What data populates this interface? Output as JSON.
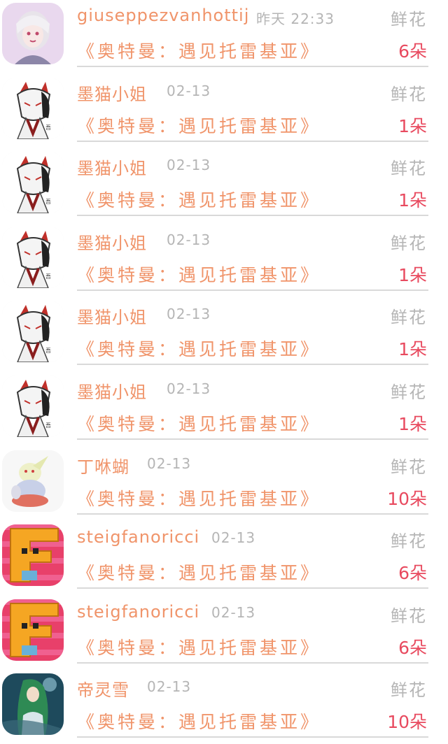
{
  "gift_list": {
    "items": [
      {
        "user": "giuseppezvanhottij",
        "time": "昨天 22:33",
        "gift_type": "鲜花",
        "book": "《奥特曼：遇见托雷基亚》",
        "amount": "6朵",
        "avatar": "girl-avatar"
      },
      {
        "user": "墨猫小姐",
        "time": "02-13",
        "gift_type": "鲜花",
        "book": "《奥特曼：遇见托雷基亚》",
        "amount": "1朵",
        "avatar": "fox-mask-avatar"
      },
      {
        "user": "墨猫小姐",
        "time": "02-13",
        "gift_type": "鲜花",
        "book": "《奥特曼：遇见托雷基亚》",
        "amount": "1朵",
        "avatar": "fox-mask-avatar"
      },
      {
        "user": "墨猫小姐",
        "time": "02-13",
        "gift_type": "鲜花",
        "book": "《奥特曼：遇见托雷基亚》",
        "amount": "1朵",
        "avatar": "fox-mask-avatar"
      },
      {
        "user": "墨猫小姐",
        "time": "02-13",
        "gift_type": "鲜花",
        "book": "《奥特曼：遇见托雷基亚》",
        "amount": "1朵",
        "avatar": "fox-mask-avatar"
      },
      {
        "user": "墨猫小姐",
        "time": "02-13",
        "gift_type": "鲜花",
        "book": "《奥特曼：遇见托雷基亚》",
        "amount": "1朵",
        "avatar": "fox-mask-avatar"
      },
      {
        "user": "丁咻蝴",
        "time": "02-13",
        "gift_type": "鲜花",
        "book": "《奥特曼：遇见托雷基亚》",
        "amount": "10朵",
        "avatar": "creature-avatar"
      },
      {
        "user": "steigfanoricci",
        "time": "02-13",
        "gift_type": "鲜花",
        "book": "《奥特曼：遇见托雷基亚》",
        "amount": "6朵",
        "avatar": "letter-f-avatar"
      },
      {
        "user": "steigfanoricci",
        "time": "02-13",
        "gift_type": "鲜花",
        "book": "《奥特曼：遇见托雷基亚》",
        "amount": "6朵",
        "avatar": "letter-f-avatar"
      },
      {
        "user": "帝灵雪",
        "time": "02-13",
        "gift_type": "鲜花",
        "book": "《奥特曼：遇见托雷基亚》",
        "amount": "10朵",
        "avatar": "green-hair-avatar"
      }
    ]
  },
  "colors": {
    "name": "#f0946a",
    "muted": "#b5b5b5",
    "amount": "#e84a5f",
    "divider": "#d9d9d9"
  }
}
